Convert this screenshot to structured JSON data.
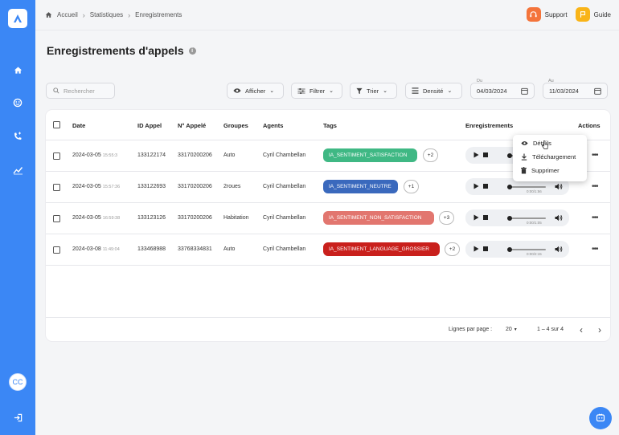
{
  "breadcrumb": {
    "home": "Accueil",
    "level1": "Statistiques",
    "current": "Enregistrements"
  },
  "header": {
    "support": "Support",
    "guide": "Guide"
  },
  "page": {
    "title": "Enregistrements d'appels"
  },
  "toolbar": {
    "search_placeholder": "Rechercher",
    "afficher": "Afficher",
    "filtrer": "Filtrer",
    "trier": "Trier",
    "densite": "Densité",
    "du_label": "Du",
    "du_value": "04/03/2024",
    "au_label": "Au",
    "au_value": "11/03/2024"
  },
  "table": {
    "columns": [
      "Date",
      "ID Appel",
      "N° Appelé",
      "Groupes",
      "Agents",
      "Tags",
      "Enregistrements",
      "Actions"
    ],
    "rows": [
      {
        "date": "2024-03-05",
        "time": "15:55:3",
        "id": "133122174",
        "numero": "33170200206",
        "groupe": "Auto",
        "agent": "Cyril Chambellan",
        "tag": "IA_SENTIMENT_SATISFACTION",
        "more": "+2",
        "duration": "0:00/1:39"
      },
      {
        "date": "2024-03-05",
        "time": "15:57:36",
        "id": "133122693",
        "numero": "33170200206",
        "groupe": "2roues",
        "agent": "Cyril Chambellan",
        "tag": "IA_SENTIMENT_NEUTRE",
        "more": "+1",
        "duration": "0:00/1:56"
      },
      {
        "date": "2024-03-05",
        "time": "16:59:38",
        "id": "133123126",
        "numero": "33170200206",
        "groupe": "Habitation",
        "agent": "Cyril Chambellan",
        "tag": "IA_SENTIMENT_NON_SATISFACTION",
        "more": "+3",
        "duration": "0:00/1:05"
      },
      {
        "date": "2024-03-08",
        "time": "11:49:04",
        "id": "133468988",
        "numero": "33768334831",
        "groupe": "Auto",
        "agent": "Cyril Chambellan",
        "tag": "IA_SENTIMENT_LANGUAGE_GROSSIER",
        "more": "+2",
        "duration": "0:00/2:15"
      }
    ]
  },
  "footer": {
    "rows_per_page_label": "Lignes par page :",
    "rows_per_page": "20",
    "range": "1 – 4 sur 4"
  },
  "menu": {
    "details": "Détails",
    "download": "Téléchargement",
    "delete": "Supprimer"
  },
  "user": {
    "initials": "CC"
  },
  "colors": {
    "primary": "#3b87f5",
    "tag_satisfaction": "#3fb884",
    "tag_neutre": "#3a69bd",
    "tag_non_satisfaction": "#e2766f",
    "tag_grossier": "#c9201c",
    "support": "#f4743b",
    "guide": "#f9b418"
  }
}
